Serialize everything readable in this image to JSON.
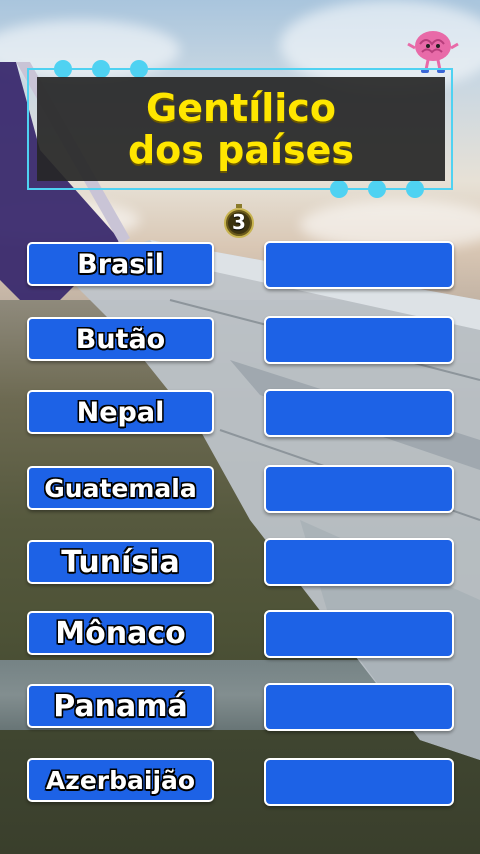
{
  "title": {
    "line1": "Gentílico",
    "line2": "dos países"
  },
  "timer": {
    "value": "3"
  },
  "countries": [
    {
      "name": "Brasil",
      "answer": ""
    },
    {
      "name": "Butão",
      "answer": ""
    },
    {
      "name": "Nepal",
      "answer": ""
    },
    {
      "name": "Guatemala",
      "answer": ""
    },
    {
      "name": "Tunísia",
      "answer": ""
    },
    {
      "name": "Mônaco",
      "answer": ""
    },
    {
      "name": "Panamá",
      "answer": ""
    },
    {
      "name": "Azerbaijão",
      "answer": ""
    }
  ],
  "icons": {
    "mascot": "brain-mascot-icon",
    "timer": "stopwatch-icon"
  },
  "colors": {
    "title_text": "#ffe600",
    "title_panel": "#262626",
    "frame_accent": "#4fd2f2",
    "box_fill": "#1d62e6",
    "box_border": "#ffffff"
  }
}
